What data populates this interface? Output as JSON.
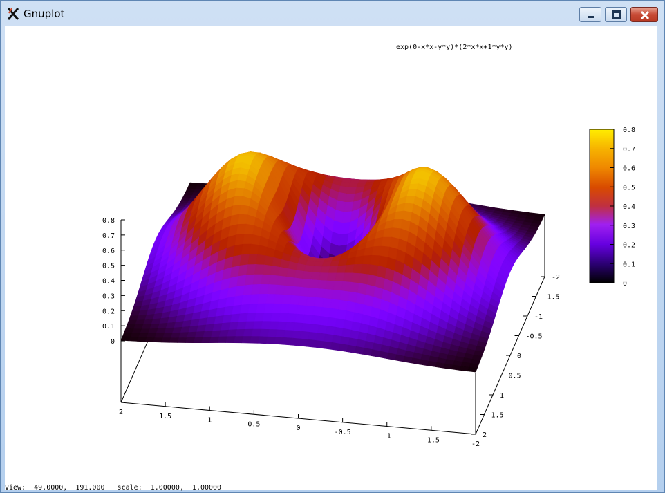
{
  "window": {
    "title": "Gnuplot",
    "controls": {
      "minimize": "minimize",
      "maximize": "maximize",
      "close": "close"
    }
  },
  "status": {
    "text": "view:  49.0000,  191.000   scale:  1.00000,  1.00000"
  },
  "chart_data": {
    "type": "surface3d",
    "title": "exp(0-x*x-y*y)*(2*x*x+1*y*y)",
    "function": "exp(0-x*x-y*y)*(2*x*x+1*y*y)",
    "view": {
      "rot_x": 49.0,
      "rot_z": 191.0,
      "scale": 1.0,
      "scale_z": 1.0
    },
    "x_range": [
      -2,
      2
    ],
    "y_range": [
      -2,
      2
    ],
    "z_range": [
      0,
      0.8
    ],
    "x_ticks": [
      "2",
      "1.5",
      "1",
      "0.5",
      "0",
      "-0.5",
      "-1",
      "-1.5",
      "-2"
    ],
    "y_ticks": [
      "-2",
      "-1.5",
      "-1",
      "-0.5",
      "0",
      "0.5",
      "1",
      "1.5",
      "2"
    ],
    "z_ticks": [
      "0",
      "0.1",
      "0.2",
      "0.3",
      "0.4",
      "0.5",
      "0.6",
      "0.7",
      "0.8"
    ],
    "colorbar": {
      "ticks": [
        "0",
        "0.1",
        "0.2",
        "0.3",
        "0.4",
        "0.5",
        "0.6",
        "0.7",
        "0.8"
      ],
      "range": [
        0,
        0.8
      ],
      "palette": "rgbformulae 7,5,15"
    },
    "grid": false,
    "legend": "none",
    "colors": {
      "axis": "#000000",
      "background": "#ffffff"
    }
  }
}
